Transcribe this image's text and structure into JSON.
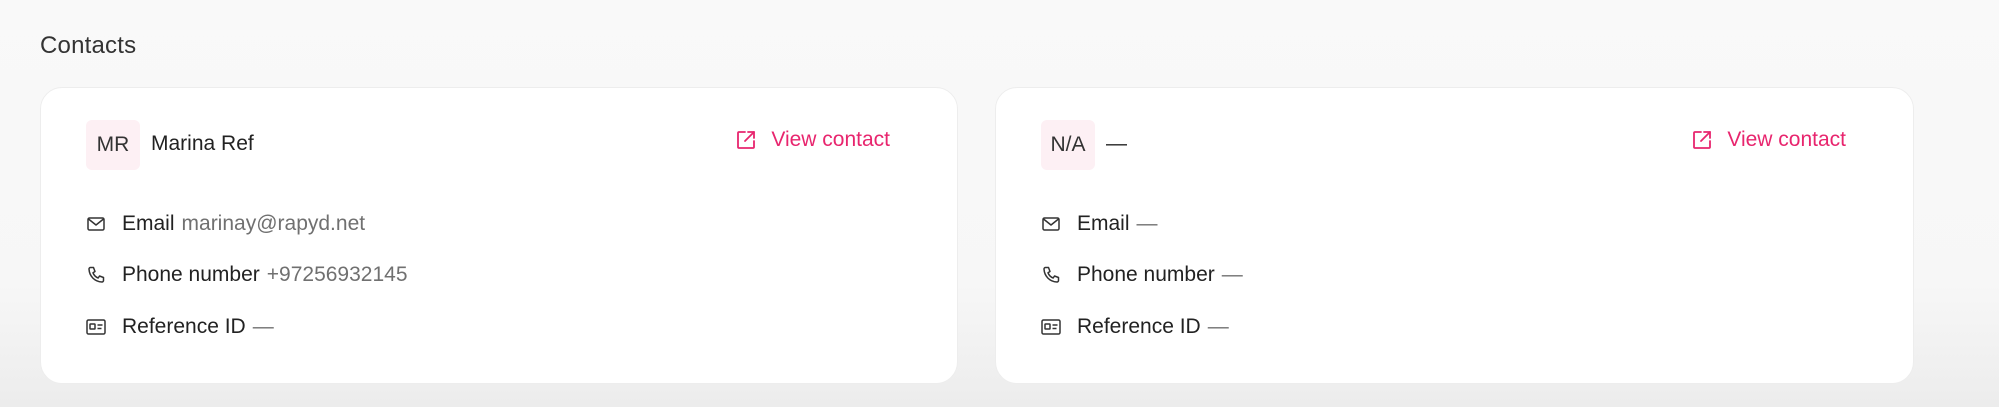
{
  "section": {
    "title": "Contacts"
  },
  "theme": {
    "accent": "#e8256e",
    "avatar_bg": "#fdf0f4"
  },
  "contacts": [
    {
      "initials": "MR",
      "name": "Marina Ref",
      "view_label": "View contact",
      "view_icon": "external-link-icon",
      "email_label": "Email",
      "email_value": "marinay@rapyd.net",
      "phone_label": "Phone number",
      "phone_value": "+97256932145",
      "ref_label": "Reference ID",
      "ref_value": "—"
    },
    {
      "initials": "N/A",
      "name": "—",
      "view_label": "View contact",
      "view_icon": "external-link-icon",
      "email_label": "Email",
      "email_value": "—",
      "phone_label": "Phone number",
      "phone_value": "—",
      "ref_label": "Reference ID",
      "ref_value": "—"
    }
  ]
}
